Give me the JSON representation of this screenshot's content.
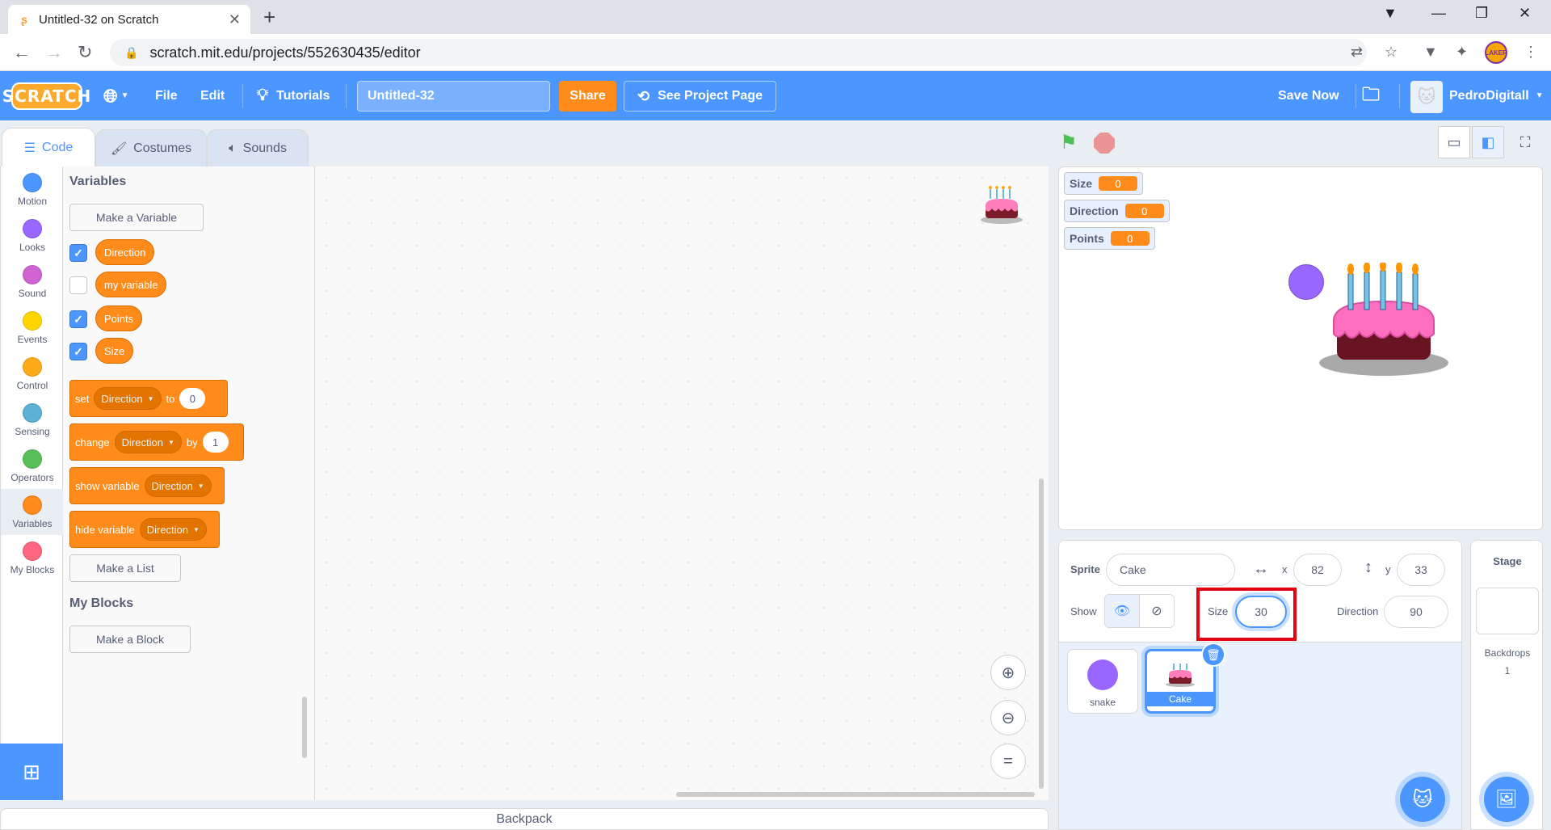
{
  "browser": {
    "tab_title": "Untitled-32 on Scratch",
    "url": "scratch.mit.edu/projects/552630435/editor",
    "profile_badge": "LAKER"
  },
  "menu": {
    "logo": "SCRATCH",
    "file": "File",
    "edit": "Edit",
    "tutorials": "Tutorials",
    "project_title": "Untitled-32",
    "share": "Share",
    "see_project_page": "See Project Page",
    "save_now": "Save Now",
    "username": "PedroDigitall"
  },
  "editor_tabs": {
    "code": "Code",
    "costumes": "Costumes",
    "sounds": "Sounds"
  },
  "categories": [
    {
      "label": "Motion",
      "color": "#4c97ff"
    },
    {
      "label": "Looks",
      "color": "#9966ff"
    },
    {
      "label": "Sound",
      "color": "#cf63cf"
    },
    {
      "label": "Events",
      "color": "#ffd500"
    },
    {
      "label": "Control",
      "color": "#ffab19"
    },
    {
      "label": "Sensing",
      "color": "#5cb1d6"
    },
    {
      "label": "Operators",
      "color": "#59c059"
    },
    {
      "label": "Variables",
      "color": "#ff8c1a"
    },
    {
      "label": "My Blocks",
      "color": "#ff6680"
    }
  ],
  "palette": {
    "variables_header": "Variables",
    "make_variable": "Make a Variable",
    "variables": [
      {
        "name": "Direction",
        "checked": true
      },
      {
        "name": "my variable",
        "checked": false
      },
      {
        "name": "Points",
        "checked": true
      },
      {
        "name": "Size",
        "checked": true
      }
    ],
    "set_block": {
      "verb": "set",
      "var": "Direction",
      "to": "to",
      "value": "0"
    },
    "change_block": {
      "verb": "change",
      "var": "Direction",
      "by": "by",
      "value": "1"
    },
    "show_block": {
      "verb": "show variable",
      "var": "Direction"
    },
    "hide_block": {
      "verb": "hide variable",
      "var": "Direction"
    },
    "make_list": "Make a List",
    "myblocks_header": "My Blocks",
    "make_block": "Make a Block"
  },
  "workspace": {
    "backpack": "Backpack"
  },
  "stage": {
    "monitors": [
      {
        "label": "Size",
        "value": "0"
      },
      {
        "label": "Direction",
        "value": "0"
      },
      {
        "label": "Points",
        "value": "0"
      }
    ]
  },
  "sprite_info": {
    "sprite_label": "Sprite",
    "sprite_name": "Cake",
    "x_label": "x",
    "x_value": "82",
    "y_label": "y",
    "y_value": "33",
    "show_label": "Show",
    "size_label": "Size",
    "size_value": "30",
    "direction_label": "Direction",
    "direction_value": "90"
  },
  "sprites": [
    {
      "name": "snake",
      "selected": false
    },
    {
      "name": "Cake",
      "selected": true
    }
  ],
  "stage_pane": {
    "title": "Stage",
    "backdrops_label": "Backdrops",
    "backdrops_count": "1"
  }
}
